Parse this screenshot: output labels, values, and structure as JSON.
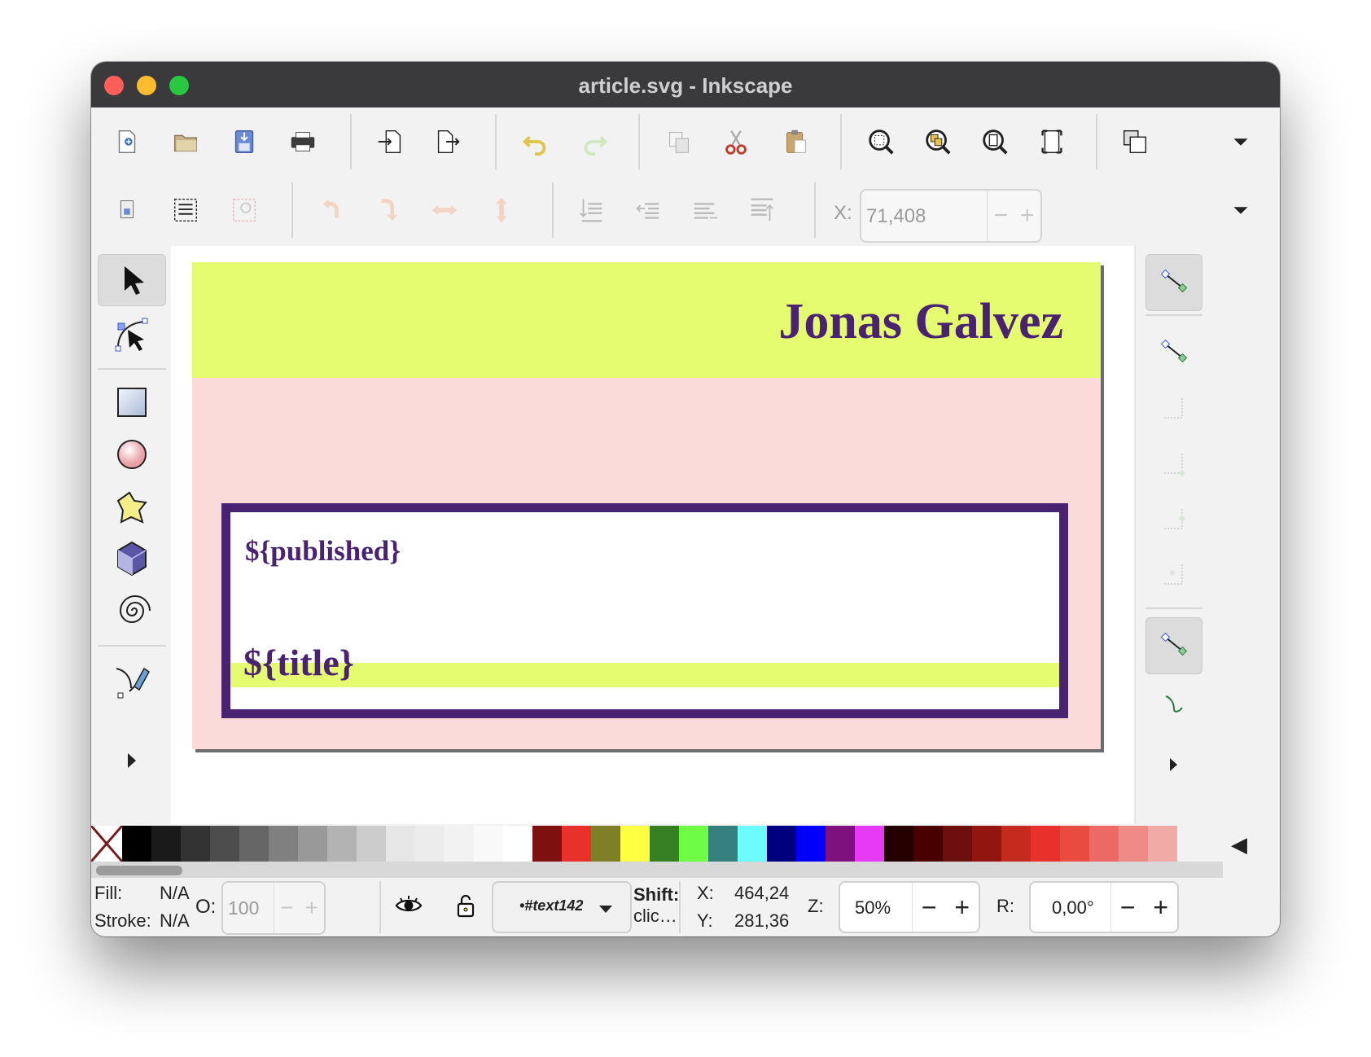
{
  "window": {
    "title": "article.svg - Inkscape"
  },
  "commands_bar": {
    "buttons": [
      "new-document",
      "open-document",
      "save-document",
      "print-document",
      "import",
      "export",
      "undo",
      "redo",
      "copy",
      "cut",
      "paste",
      "zoom-selection",
      "zoom-drawing",
      "zoom-page",
      "zoom-fit-width",
      "duplicate"
    ]
  },
  "select_toolbar": {
    "x_label": "X:",
    "x_value": "71,408",
    "minus": "−",
    "plus": "+"
  },
  "document": {
    "header_name": "Jonas Galvez",
    "published_placeholder": "${published}",
    "title_placeholder": "${title}",
    "colors": {
      "header_bg": "#e5fb70",
      "page_bg": "#fadbd9",
      "frame_border": "#4a2272",
      "text": "#4a2272",
      "title_highlight": "#e5fb70"
    }
  },
  "palette": {
    "swatches": [
      "#000000",
      "#1a1a1a",
      "#333333",
      "#4d4d4d",
      "#666666",
      "#808080",
      "#999999",
      "#b3b3b3",
      "#cccccc",
      "#e6e6e6",
      "#ececec",
      "#f2f2f2",
      "#f9f9f9",
      "#ffffff",
      "#7f1010",
      "#e8312a",
      "#7f7f27",
      "#ffff44",
      "#367f22",
      "#6ffc44",
      "#367f7f",
      "#6dfcfc",
      "#00007f",
      "#0000fb",
      "#7f117f",
      "#e63af6",
      "#240000",
      "#490000",
      "#6d0f0f",
      "#92150f",
      "#c42a1d",
      "#e8312a",
      "#e94b3e",
      "#ec6a63",
      "#ef8b86",
      "#f2aaa7"
    ],
    "arrow": "◀"
  },
  "statusbar": {
    "fill_label": "Fill:",
    "fill_value": "N/A",
    "stroke_label": "Stroke:",
    "stroke_value": "N/A",
    "opacity_label": "O:",
    "opacity_value": "100",
    "layer_name": "•#text142",
    "hint_bold": "Shift:",
    "hint_text": "clic…",
    "cursor_x_label": "X:",
    "cursor_x": "464,24",
    "cursor_y_label": "Y:",
    "cursor_y": "281,36",
    "zoom_label": "Z:",
    "zoom_value": "50%",
    "rotation_label": "R:",
    "rotation_value": "0,00°",
    "minus": "−",
    "plus": "+"
  }
}
